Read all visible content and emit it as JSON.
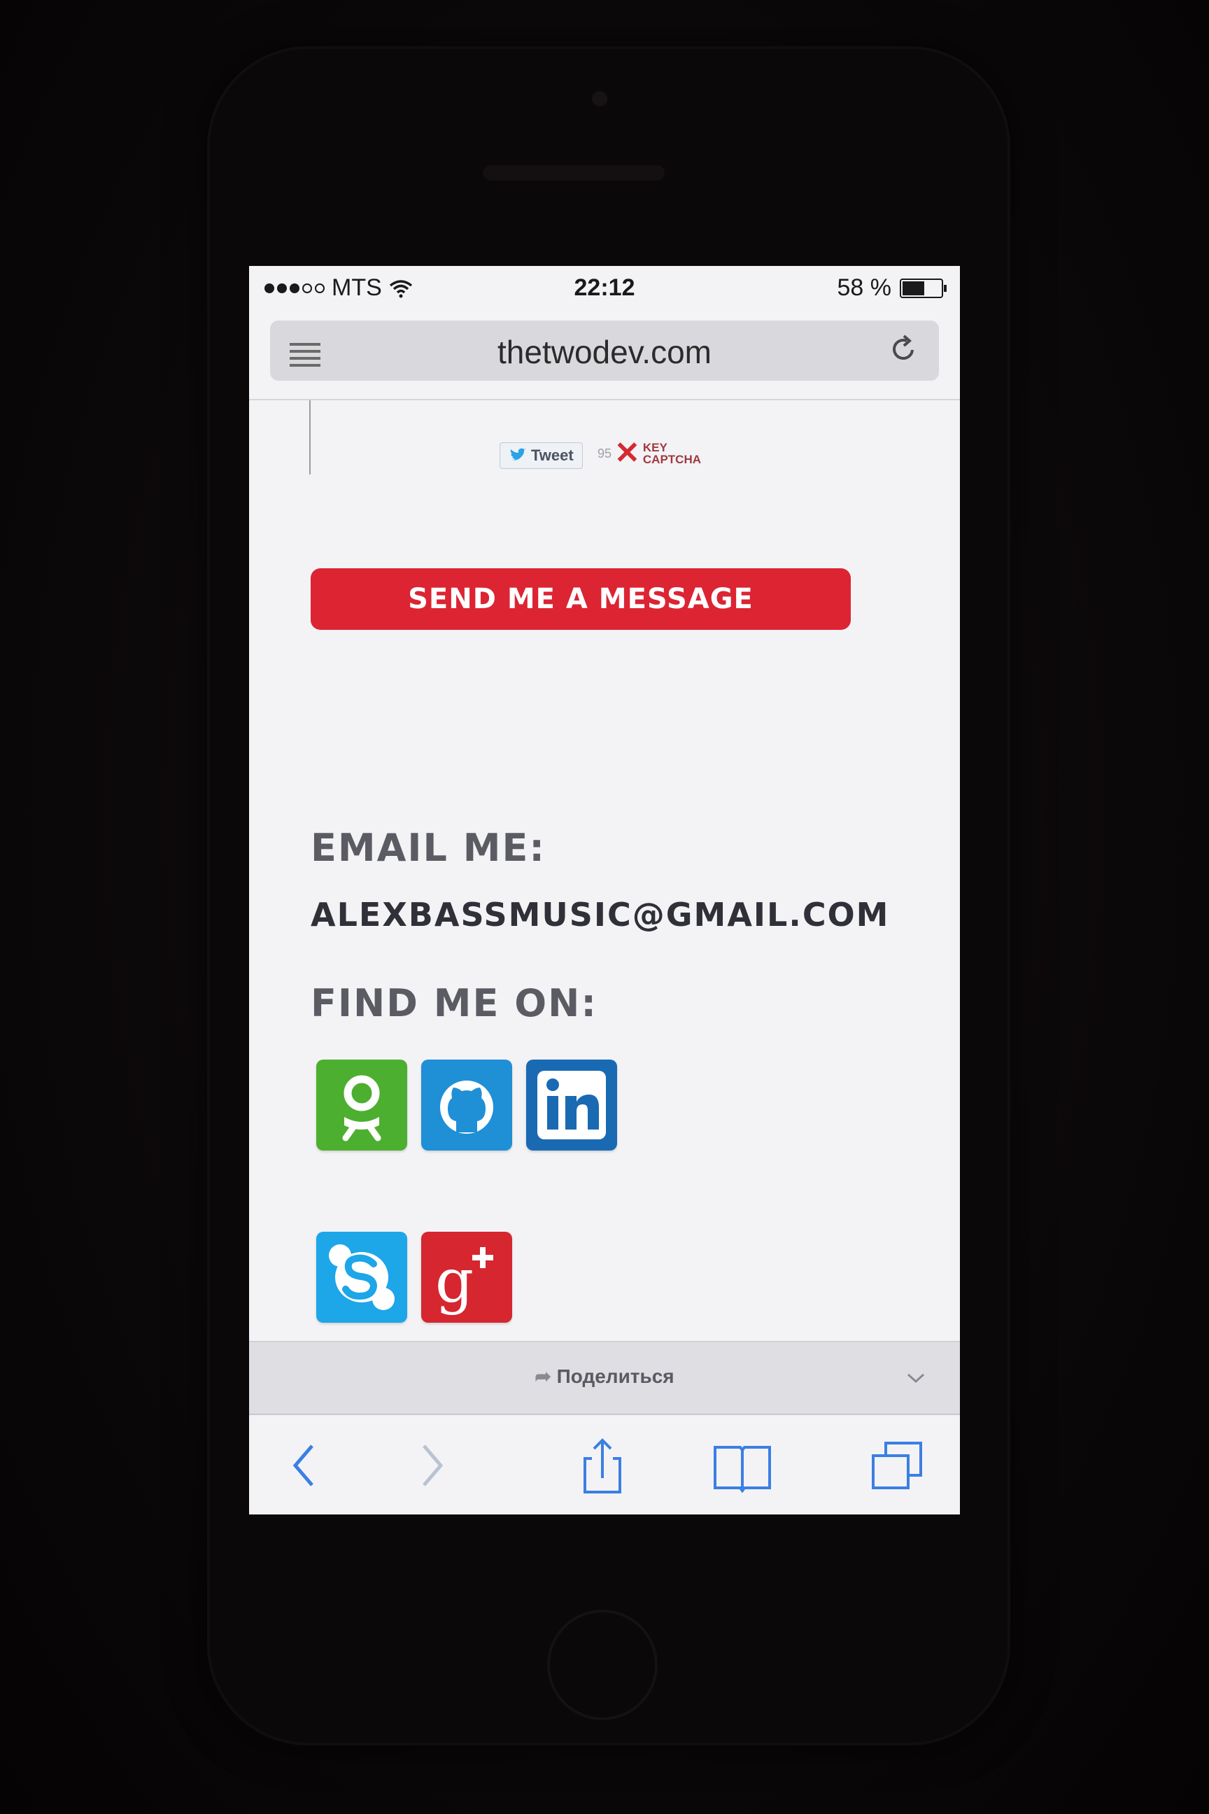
{
  "status_bar": {
    "carrier": "MTS",
    "time": "22:12",
    "battery": "58 %",
    "battery_level": 0.58,
    "signal_bars": 3
  },
  "browser": {
    "url": "thetwodev.com",
    "share_label": "Поделиться"
  },
  "embed": {
    "tweet_label": "Tweet",
    "captcha_brand_line1": "KEY",
    "captcha_brand_line2": "CAPTCHA",
    "captcha_count": "95"
  },
  "contact": {
    "send_button": "SEND ME A MESSAGE",
    "email_heading": "EMAIL ME:",
    "email_address": "ALEXBASSMUSIC@GMAIL.COM",
    "find_heading": "FIND ME ON:"
  },
  "social_links": [
    {
      "icon": "odnoklassniki-icon",
      "color": "#4caf2f"
    },
    {
      "icon": "github-icon",
      "color": "#1f8fd6"
    },
    {
      "icon": "linkedin-icon",
      "color": "#1a6ab3"
    },
    {
      "icon": "skype-icon",
      "color": "#1da6e8"
    },
    {
      "icon": "google-plus-icon",
      "color": "#d6262f"
    }
  ],
  "colors": {
    "accent": "#dc2433",
    "ios_blue": "#3b7fe3"
  }
}
